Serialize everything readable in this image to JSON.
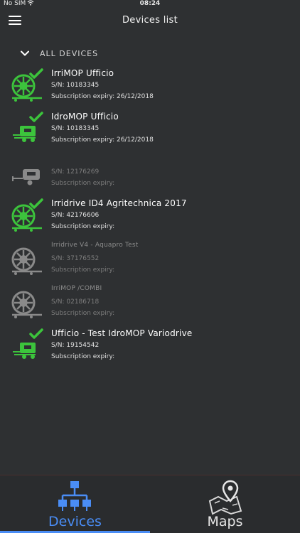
{
  "status_bar": {
    "carrier": "No SIM",
    "time": "08:24"
  },
  "nav": {
    "title": "Devices list"
  },
  "section": {
    "title": "ALL DEVICES"
  },
  "devices": [
    {
      "name": "IrriMOP Ufficio",
      "sn": "S/N: 10183345",
      "expiry": "Subscription expiry: 26/12/2018",
      "icon": "reel-icon",
      "active": true
    },
    {
      "name": "IdroMOP Ufficio",
      "sn": "S/N: 10183345",
      "expiry": "Subscription expiry: 26/12/2018",
      "icon": "cart-icon",
      "active": true
    },
    {
      "name": "",
      "sn": "S/N: 12176269",
      "expiry": "Subscription expiry:",
      "icon": "trailer-icon",
      "active": false
    },
    {
      "name": "Irridrive ID4 Agritechnica 2017",
      "sn": "S/N: 42176606",
      "expiry": "Subscription expiry:",
      "icon": "reel-icon",
      "active": true
    },
    {
      "name": "Irridrive V4 - Aquapro Test",
      "sn": "S/N: 37176552",
      "expiry": "Subscription expiry:",
      "icon": "reel-icon",
      "active": false
    },
    {
      "name": "IrriMOP /COMBI",
      "sn": "S/N: 02186718",
      "expiry": "Subscription expiry:",
      "icon": "reel-icon",
      "active": false
    },
    {
      "name": "Ufficio - Test IdroMOP Variodrive",
      "sn": "S/N: 19154542",
      "expiry": "Subscription expiry:",
      "icon": "cart-icon",
      "active": true
    }
  ],
  "tabs": {
    "devices": "Devices",
    "maps": "Maps"
  },
  "colors": {
    "background": "#2e3032",
    "active_green": "#3cc43c",
    "inactive_gray": "#8a8a8a",
    "accent_blue": "#4a8df5"
  }
}
